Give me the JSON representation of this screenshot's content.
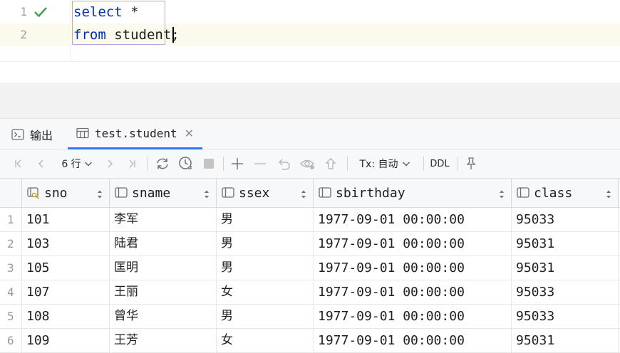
{
  "editor": {
    "lines": [
      {
        "number": "1",
        "keyword": "select",
        "rest": " *"
      },
      {
        "number": "2",
        "keyword": "from",
        "rest": " student;"
      }
    ]
  },
  "tabs": [
    {
      "label": "输出",
      "icon": "console-icon",
      "active": false
    },
    {
      "label": "test.student",
      "icon": "table-icon",
      "active": true
    }
  ],
  "toolbar": {
    "row_count": "6 行",
    "tx_label": "Tx: 自动",
    "ddl_label": "DDL"
  },
  "grid": {
    "columns": [
      {
        "name": "sno",
        "icon": "primary-key-column-icon"
      },
      {
        "name": "sname",
        "icon": "column-icon"
      },
      {
        "name": "ssex",
        "icon": "column-icon"
      },
      {
        "name": "sbirthday",
        "icon": "column-icon"
      },
      {
        "name": "class",
        "icon": "column-icon"
      }
    ],
    "rows": [
      {
        "n": "1",
        "cells": [
          "101",
          "李军",
          "男",
          "1977-09-01 00:00:00",
          "95033"
        ]
      },
      {
        "n": "2",
        "cells": [
          "103",
          "陆君",
          "男",
          "1977-09-01 00:00:00",
          "95031"
        ]
      },
      {
        "n": "3",
        "cells": [
          "105",
          "匡明",
          "男",
          "1977-09-01 00:00:00",
          "95031"
        ]
      },
      {
        "n": "4",
        "cells": [
          "107",
          "王丽",
          "女",
          "1977-09-01 00:00:00",
          "95033"
        ]
      },
      {
        "n": "5",
        "cells": [
          "108",
          "曾华",
          "男",
          "1977-09-01 00:00:00",
          "95033"
        ]
      },
      {
        "n": "6",
        "cells": [
          "109",
          "王芳",
          "女",
          "1977-09-01 00:00:00",
          "95031"
        ]
      }
    ]
  },
  "colors": {
    "accent": "#3574f0",
    "keyword": "#0033b3",
    "check": "#4a9c5b"
  }
}
